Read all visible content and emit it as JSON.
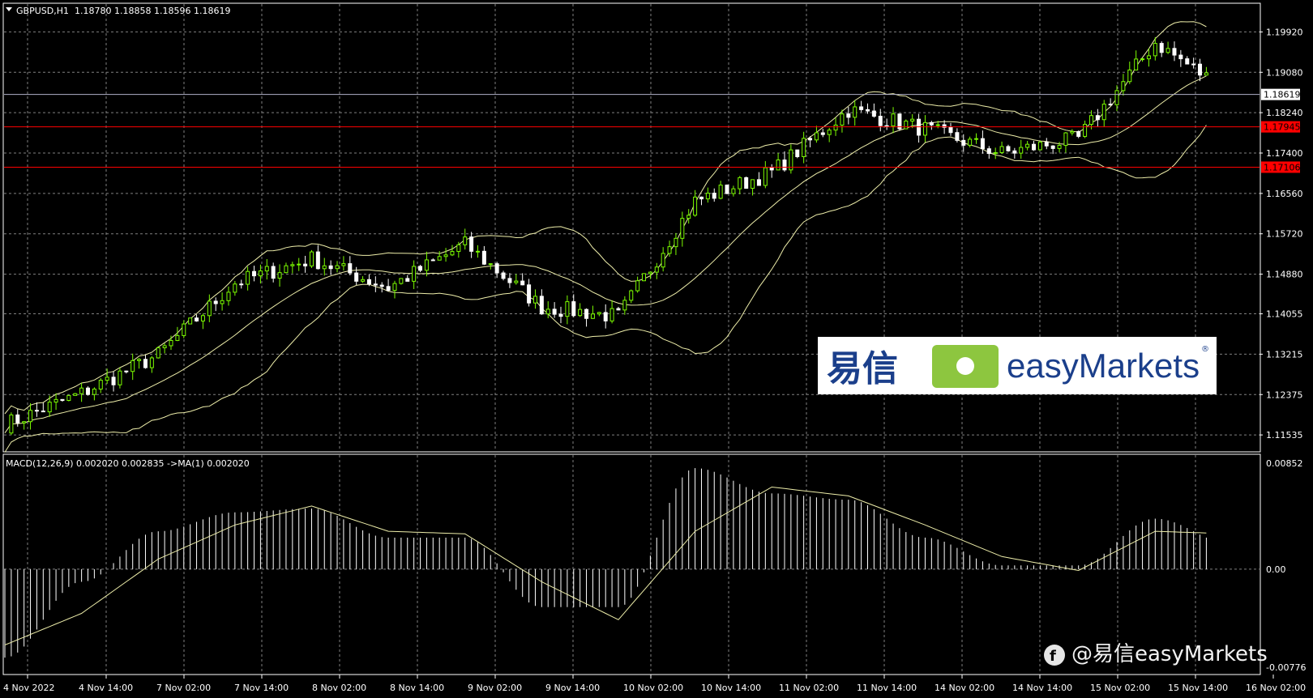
{
  "header": {
    "symbol": "GBPUSD,H1",
    "ohlc": "1.18780 1.18858 1.18596 1.18619"
  },
  "macd_header": "MACD(12,26,9) 0.002020 0.002835  ->MA(1) 0.002020",
  "colors": {
    "background": "#000000",
    "grid": "#808080",
    "bull_candle": "#7CFC00",
    "bear_candle": "#FFFFFF",
    "bands": "#EEEEAA",
    "level_line": "#FF0000",
    "current_price_line": "#B0B0C8"
  },
  "price_axis": {
    "ticks": [
      "1.19920",
      "1.19080",
      "1.18240",
      "1.17400",
      "1.16560",
      "1.15720",
      "1.14880",
      "1.14055",
      "1.13215",
      "1.12375",
      "1.11535"
    ],
    "current_price": "1.18619",
    "levels": [
      "1.17945",
      "1.17106"
    ]
  },
  "macd_axis": {
    "ticks": [
      "0.00852",
      "0.00",
      "-0.00776"
    ]
  },
  "time_axis": {
    "labels": [
      "4 Nov 2022",
      "4 Nov 14:00",
      "7 Nov 02:00",
      "7 Nov 14:00",
      "8 Nov 02:00",
      "8 Nov 14:00",
      "9 Nov 02:00",
      "9 Nov 14:00",
      "10 Nov 02:00",
      "10 Nov 14:00",
      "11 Nov 02:00",
      "11 Nov 14:00",
      "14 Nov 02:00",
      "14 Nov 14:00",
      "15 Nov 02:00",
      "15 Nov 14:00",
      "16 Nov 02:00"
    ]
  },
  "logo": {
    "chinese": "易信",
    "brand": "easyMarkets",
    "registered": "®",
    "icon": "easymarkets-square-icon"
  },
  "watermark": {
    "icon": "facebook-icon",
    "text": "@易信easyMarkets"
  },
  "chart_data": [
    {
      "type": "candlestick",
      "title": "GBPUSD,H1",
      "indicators": [
        "Bollinger Bands"
      ],
      "ylim": [
        1.112,
        1.205
      ],
      "horizontal_levels": [
        1.17945,
        1.17106
      ],
      "current_price": 1.18619,
      "anchors": [
        {
          "x": "4 Nov 2022",
          "close": 1.1175
        },
        {
          "x": "4 Nov 14:00",
          "close": 1.124
        },
        {
          "x": "7 Nov 02:00",
          "close": 1.132
        },
        {
          "x": "7 Nov 14:00",
          "close": 1.147
        },
        {
          "x": "8 Nov 02:00",
          "close": 1.152
        },
        {
          "x": "8 Nov 14:00",
          "close": 1.146
        },
        {
          "x": "9 Nov 02:00",
          "close": 1.155
        },
        {
          "x": "9 Nov 14:00",
          "close": 1.142
        },
        {
          "x": "10 Nov 02:00",
          "close": 1.14
        },
        {
          "x": "10 Nov 14:00",
          "close": 1.164
        },
        {
          "x": "11 Nov 02:00",
          "close": 1.17
        },
        {
          "x": "11 Nov 14:00",
          "close": 1.183
        },
        {
          "x": "14 Nov 02:00",
          "close": 1.179
        },
        {
          "x": "14 Nov 14:00",
          "close": 1.174
        },
        {
          "x": "15 Nov 02:00",
          "close": 1.177
        },
        {
          "x": "15 Nov 14:00",
          "close": 1.197
        },
        {
          "x": "16 Nov 02:00",
          "close": 1.1862
        }
      ]
    },
    {
      "type": "bar",
      "title": "MACD(12,26,9) 0.002020 0.002835  ->MA(1) 0.002020",
      "ylim": [
        -0.00776,
        0.00852
      ],
      "anchors": [
        {
          "x": "4 Nov 2022",
          "macd": -0.007,
          "signal": -0.006
        },
        {
          "x": "4 Nov 14:00",
          "macd": -0.001,
          "signal": -0.0035
        },
        {
          "x": "7 Nov 02:00",
          "macd": 0.003,
          "signal": 0.0008
        },
        {
          "x": "7 Nov 14:00",
          "macd": 0.0045,
          "signal": 0.0035
        },
        {
          "x": "8 Nov 02:00",
          "macd": 0.0048,
          "signal": 0.005
        },
        {
          "x": "8 Nov 14:00",
          "macd": 0.0025,
          "signal": 0.003
        },
        {
          "x": "9 Nov 02:00",
          "macd": 0.0025,
          "signal": 0.0028
        },
        {
          "x": "9 Nov 14:00",
          "macd": -0.003,
          "signal": -0.001
        },
        {
          "x": "10 Nov 02:00",
          "macd": -0.003,
          "signal": -0.004
        },
        {
          "x": "10 Nov 14:00",
          "macd": 0.008,
          "signal": 0.003
        },
        {
          "x": "11 Nov 02:00",
          "macd": 0.006,
          "signal": 0.0065
        },
        {
          "x": "11 Nov 14:00",
          "macd": 0.0055,
          "signal": 0.0058
        },
        {
          "x": "14 Nov 02:00",
          "macd": 0.0025,
          "signal": 0.0035
        },
        {
          "x": "14 Nov 14:00",
          "macd": 0.0003,
          "signal": 0.001
        },
        {
          "x": "15 Nov 02:00",
          "macd": 0.0003,
          "signal": -0.0001
        },
        {
          "x": "15 Nov 14:00",
          "macd": 0.004,
          "signal": 0.003
        },
        {
          "x": "16 Nov 02:00",
          "macd": 0.002,
          "signal": 0.0028
        }
      ]
    }
  ]
}
